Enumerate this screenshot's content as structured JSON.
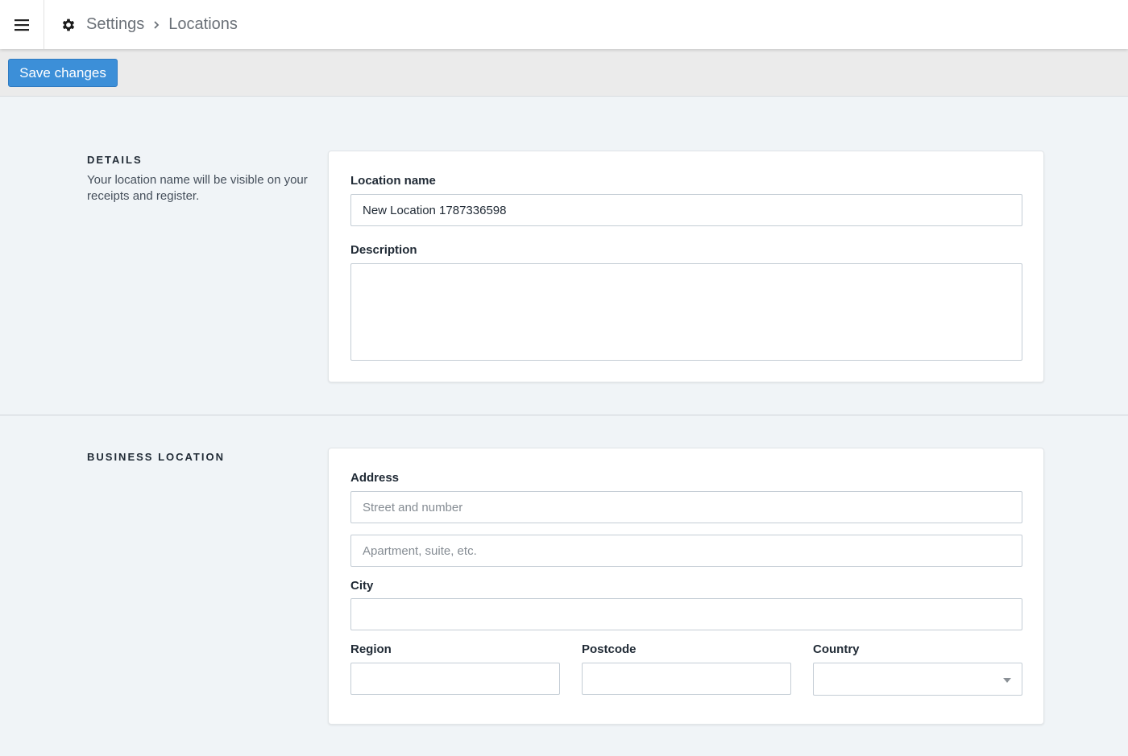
{
  "topbar": {
    "menu_icon": "hamburger-menu-icon",
    "settings_icon": "gear-icon",
    "breadcrumb": [
      "Settings",
      "Locations"
    ],
    "separator_icon": "chevron-right-icon"
  },
  "actions": {
    "save_label": "Save changes",
    "accent_color": "#3c8fd8"
  },
  "details": {
    "heading": "DETAILS",
    "description": "Your location name will be visible on your receipts and register.",
    "location_name_label": "Location name",
    "location_name_value": "New Location 1787336598",
    "description_label": "Description",
    "description_value": ""
  },
  "business_location": {
    "heading": "BUSINESS LOCATION",
    "address_label": "Address",
    "street_placeholder": "Street and number",
    "apartment_placeholder": "Apartment, suite, etc.",
    "city_label": "City",
    "region_label": "Region",
    "postcode_label": "Postcode",
    "country_label": "Country",
    "country_value": ""
  }
}
